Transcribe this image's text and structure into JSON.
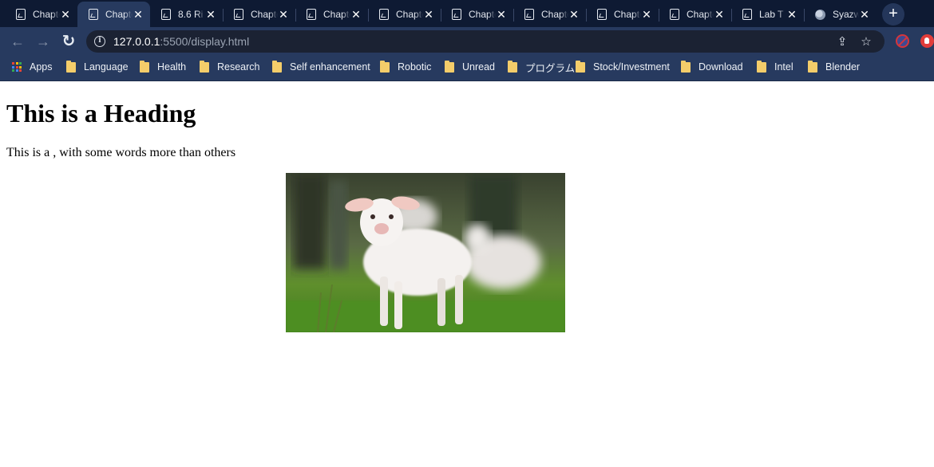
{
  "tabs": [
    {
      "title": "Chapter",
      "icon": "document-icon",
      "active": false
    },
    {
      "title": "Chapter",
      "icon": "document-icon",
      "active": true
    },
    {
      "title": "8.6 Ri",
      "icon": "document-icon",
      "active": false
    },
    {
      "title": "Chapter",
      "icon": "document-icon",
      "active": false
    },
    {
      "title": "Chapter",
      "icon": "document-icon",
      "active": false
    },
    {
      "title": "Chapter",
      "icon": "document-icon",
      "active": false
    },
    {
      "title": "Chapter",
      "icon": "document-icon",
      "active": false
    },
    {
      "title": "Chapter",
      "icon": "document-icon",
      "active": false
    },
    {
      "title": "Chapter",
      "icon": "document-icon",
      "active": false
    },
    {
      "title": "Chapter",
      "icon": "document-icon",
      "active": false
    },
    {
      "title": "Lab T",
      "icon": "document-icon",
      "active": false
    },
    {
      "title": "Syazw",
      "icon": "globe-icon",
      "active": false
    }
  ],
  "tab_close_glyph": "✕",
  "newtab_glyph": "+",
  "toolbar": {
    "back_glyph": "←",
    "forward_glyph": "→",
    "reload_glyph": "↻",
    "info_glyph": "i",
    "url_host": "127.0.0.1",
    "url_rest": ":5500/display.html",
    "share_glyph": "⇪",
    "star_glyph": "☆"
  },
  "bookmarks": [
    {
      "label": "Apps",
      "icon": "apps-grid-icon"
    },
    {
      "label": "Language",
      "icon": "folder-icon"
    },
    {
      "label": "Health",
      "icon": "folder-icon"
    },
    {
      "label": "Research",
      "icon": "folder-icon"
    },
    {
      "label": "Self enhancement",
      "icon": "folder-icon"
    },
    {
      "label": "Robotic",
      "icon": "folder-icon"
    },
    {
      "label": "Unread",
      "icon": "folder-icon"
    },
    {
      "label": "プログラム",
      "icon": "folder-icon"
    },
    {
      "label": "Stock/Investment",
      "icon": "folder-icon"
    },
    {
      "label": "Download",
      "icon": "folder-icon"
    },
    {
      "label": "Intel",
      "icon": "folder-icon"
    },
    {
      "label": "Blender",
      "icon": "folder-icon"
    }
  ],
  "content": {
    "heading": "This is a Heading",
    "paragraph": "This is a , with some words more than others",
    "image": "lamb-photo"
  },
  "colors": {
    "tabstrip_bg": "#0e1a33",
    "toolbar_bg": "#273a5f",
    "omnibox_bg": "#1b2233",
    "folder": "#f4cd6a"
  }
}
